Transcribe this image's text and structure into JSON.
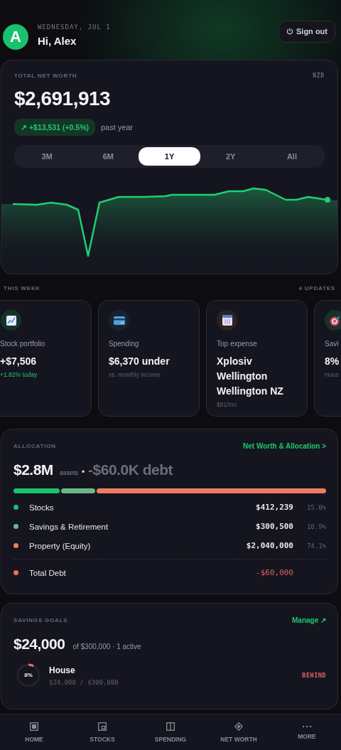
{
  "header": {
    "avatar": "A",
    "date": "WEDNESDAY, JUL 1",
    "greeting": "Hi, Alex",
    "sign_out": "Sign out"
  },
  "net_worth": {
    "label": "TOTAL NET WORTH",
    "currency": "NZD",
    "value": "$2,691,913",
    "change": "↗ +$13,531 (+0.5%)",
    "change_period": "past year",
    "ranges": [
      {
        "label": "3M",
        "selected": false
      },
      {
        "label": "6M",
        "selected": false
      },
      {
        "label": "1Y",
        "selected": true
      },
      {
        "label": "2Y",
        "selected": false
      },
      {
        "label": "All",
        "selected": false
      }
    ]
  },
  "this_week": {
    "label": "THIS WEEK",
    "count": "4 UPDATES",
    "cards": [
      {
        "kind": "stocks",
        "title": "Stock portfolio",
        "value": "+$7,506",
        "note": "+1.82% today",
        "note_positive": true
      },
      {
        "kind": "spending",
        "title": "Spending",
        "value": "$6,370 under",
        "note": "vs. monthly income",
        "note_positive": false
      },
      {
        "kind": "expense",
        "title": "Top expense",
        "value": "Xplosiv Wellington Wellington NZ",
        "note": "$81/mo",
        "note_positive": false
      },
      {
        "kind": "goal",
        "title": "Savi",
        "value": "8%",
        "note": "Hous",
        "note_positive": false
      }
    ]
  },
  "allocation": {
    "label": "ALLOCATION",
    "link": "Net Worth & Allocation >",
    "assets": "$2.8M",
    "assets_label": "assets",
    "separator": "•",
    "debt": "-$60.0K debt",
    "items": [
      {
        "name": "Stocks",
        "amount": "$412,239",
        "share": "15.0%",
        "color": "#16c46c"
      },
      {
        "name": "Savings & Retirement",
        "amount": "$300,500",
        "share": "10.9%",
        "color": "#6cb88a"
      },
      {
        "name": "Property (Equity)",
        "amount": "$2,040,000",
        "share": "74.1%",
        "color": "#f07c62"
      }
    ],
    "debt_row": {
      "name": "Total Debt",
      "amount": "-$60,000",
      "color": "#f06a6a"
    }
  },
  "savings": {
    "label": "SAVINGS GOALS",
    "link": "Manage ↗",
    "total": "$24,000",
    "summary": "of $300,000 · 1 active",
    "goals": [
      {
        "name": "House",
        "progress": "$24,000 / $300,000",
        "percent": "8%",
        "level": 0.08,
        "status": "BEHIND",
        "on_track": false
      }
    ]
  },
  "nav": [
    {
      "kind": "home",
      "label": "HOME",
      "selected": false
    },
    {
      "kind": "stocks",
      "label": "STOCKS",
      "selected": false
    },
    {
      "kind": "spending",
      "label": "SPENDING",
      "selected": false
    },
    {
      "kind": "networth",
      "label": "NET WORTH",
      "selected": false
    },
    {
      "kind": "more",
      "label": "MORE",
      "selected": false
    }
  ]
}
